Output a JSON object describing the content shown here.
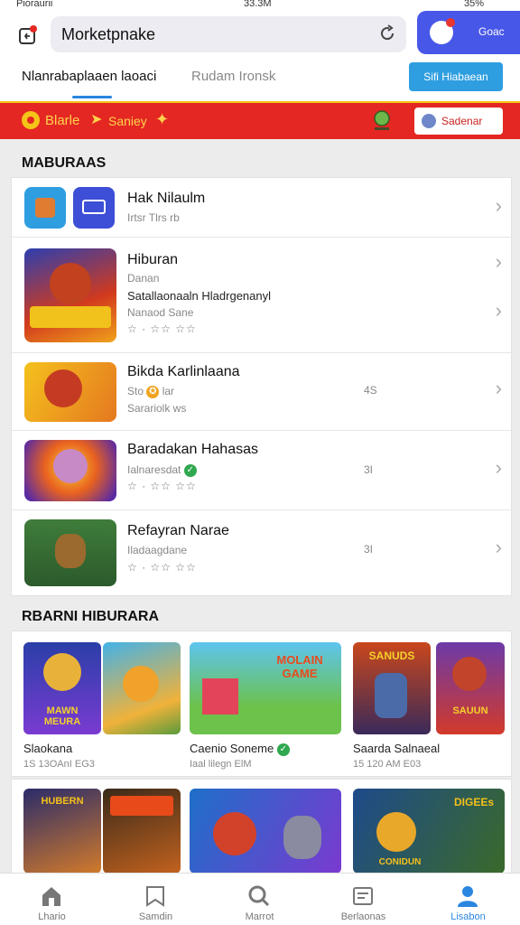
{
  "status_bar": {
    "left": "Pioraurii",
    "center": "33.3M",
    "right": "35%"
  },
  "header": {
    "search_text": "Morketpnake",
    "profile_label": "Goac"
  },
  "tabs": {
    "active": "Nlanrabaplaaen laoaci",
    "inactive": "Rudam Ironsk",
    "button": "Sifi Hiabaean"
  },
  "banner": {
    "item1": "Blarle",
    "item2": "Saniey",
    "button": "Sadenar"
  },
  "section1": {
    "title": "MABURAAS",
    "rows": [
      {
        "title": "Hak Nilaulm",
        "sub": "Irtsr Tlrs rb"
      },
      {
        "title": "Hiburan",
        "sub": "Danan",
        "desc": "Satallaonaaln Hladrgenanyl",
        "meta": "Nanaod Sane",
        "stars": "☆ · ☆☆ ☆☆"
      },
      {
        "title": "Bikda Karlinlaana",
        "sub": "Sto",
        "sub2": "lar",
        "meta": "Sarariolk ws",
        "num": "4S"
      },
      {
        "title": "Baradakan Hahasas",
        "sub": "Ialnaresdat",
        "stars": "☆ · ☆☆ ☆☆",
        "num": "3I"
      },
      {
        "title": "Refayran Narae",
        "sub": "Iladaagdane",
        "stars": "☆ · ☆☆ ☆☆",
        "num": "3I"
      }
    ]
  },
  "section2": {
    "title": "RBARNI HIBURARA",
    "items": [
      {
        "name": "Slaokana",
        "sub": "1S 13OAnI EG3"
      },
      {
        "name": "Caenio Soneme",
        "sub": "Iaal lilegn ElM"
      },
      {
        "name": "Saarda Salnaeal",
        "sub": "15 120 AM E03"
      }
    ],
    "art_texts": {
      "a": "MAWN MEURA",
      "b": "MOLAIN GAME",
      "c": "SANUDS",
      "d": "SAUUN",
      "e": "DIGEEs",
      "f": "CONIDUN",
      "g": "HUBERN"
    }
  },
  "bottom_nav": [
    "Lhario",
    "Samdin",
    "Marrot",
    "Berlaonas",
    "Lisabon"
  ],
  "colors": {
    "accent": "#2a86e0",
    "banner": "#e42722",
    "profile": "#4757e8"
  }
}
